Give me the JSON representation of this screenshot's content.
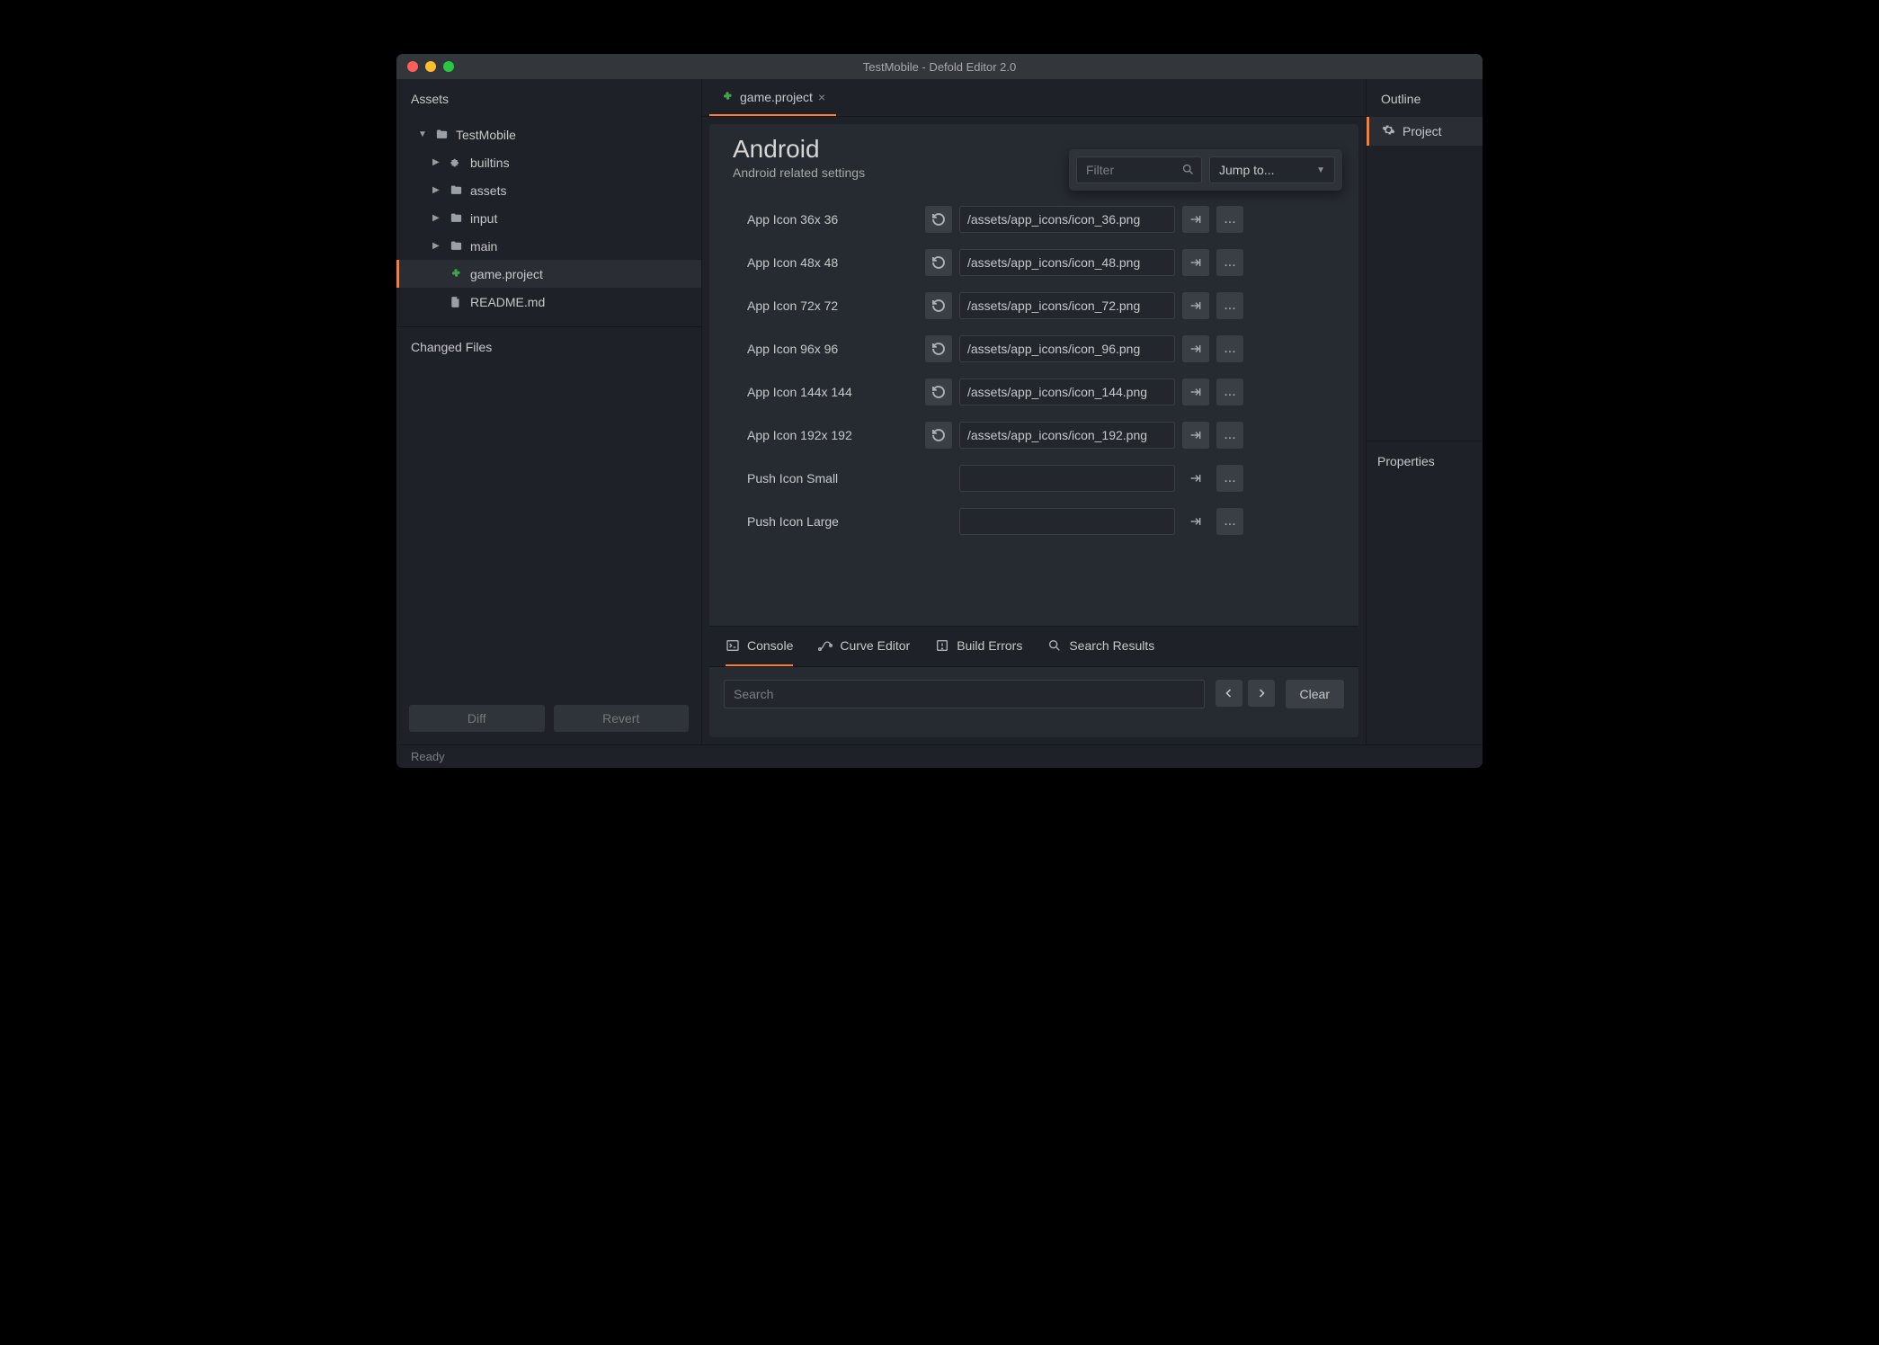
{
  "window": {
    "title": "TestMobile - Defold Editor 2.0"
  },
  "assets": {
    "header": "Assets",
    "tree": [
      {
        "label": "TestMobile",
        "indent": 0,
        "caret": "down",
        "icon": "folder"
      },
      {
        "label": "builtins",
        "indent": 1,
        "caret": "right",
        "icon": "puzzle"
      },
      {
        "label": "assets",
        "indent": 1,
        "caret": "right",
        "icon": "folder"
      },
      {
        "label": "input",
        "indent": 1,
        "caret": "right",
        "icon": "folder"
      },
      {
        "label": "main",
        "indent": 1,
        "caret": "right",
        "icon": "folder"
      },
      {
        "label": "game.project",
        "indent": 1,
        "caret": "",
        "icon": "clover",
        "selected": true
      },
      {
        "label": "README.md",
        "indent": 1,
        "caret": "",
        "icon": "file"
      }
    ],
    "changed_files_header": "Changed Files",
    "diff_btn": "Diff",
    "revert_btn": "Revert"
  },
  "tabs": [
    {
      "label": "game.project",
      "icon": "clover",
      "active": true
    }
  ],
  "section": {
    "title": "Android",
    "subtitle": "Android related settings"
  },
  "toolbar": {
    "filter_placeholder": "Filter",
    "jump_label": "Jump to..."
  },
  "form": [
    {
      "label": "App Icon 36x 36",
      "value": "/assets/app_icons/icon_36.png",
      "reset": true,
      "open": true
    },
    {
      "label": "App Icon 48x 48",
      "value": "/assets/app_icons/icon_48.png",
      "reset": true,
      "open": true
    },
    {
      "label": "App Icon 72x 72",
      "value": "/assets/app_icons/icon_72.png",
      "reset": true,
      "open": true
    },
    {
      "label": "App Icon 96x 96",
      "value": "/assets/app_icons/icon_96.png",
      "reset": true,
      "open": true
    },
    {
      "label": "App Icon 144x 144",
      "value": "/assets/app_icons/icon_144.png",
      "reset": true,
      "open": true
    },
    {
      "label": "App Icon 192x 192",
      "value": "/assets/app_icons/icon_192.png",
      "reset": true,
      "open": true
    },
    {
      "label": "Push Icon Small",
      "value": "",
      "reset": false,
      "open": false
    },
    {
      "label": "Push Icon Large",
      "value": "",
      "reset": false,
      "open": false
    }
  ],
  "bottom_tabs": {
    "console": "Console",
    "curve_editor": "Curve Editor",
    "build_errors": "Build Errors",
    "search_results": "Search Results"
  },
  "console": {
    "search_placeholder": "Search",
    "clear_label": "Clear"
  },
  "outline": {
    "header": "Outline",
    "item": "Project"
  },
  "properties": {
    "header": "Properties"
  },
  "status": "Ready"
}
